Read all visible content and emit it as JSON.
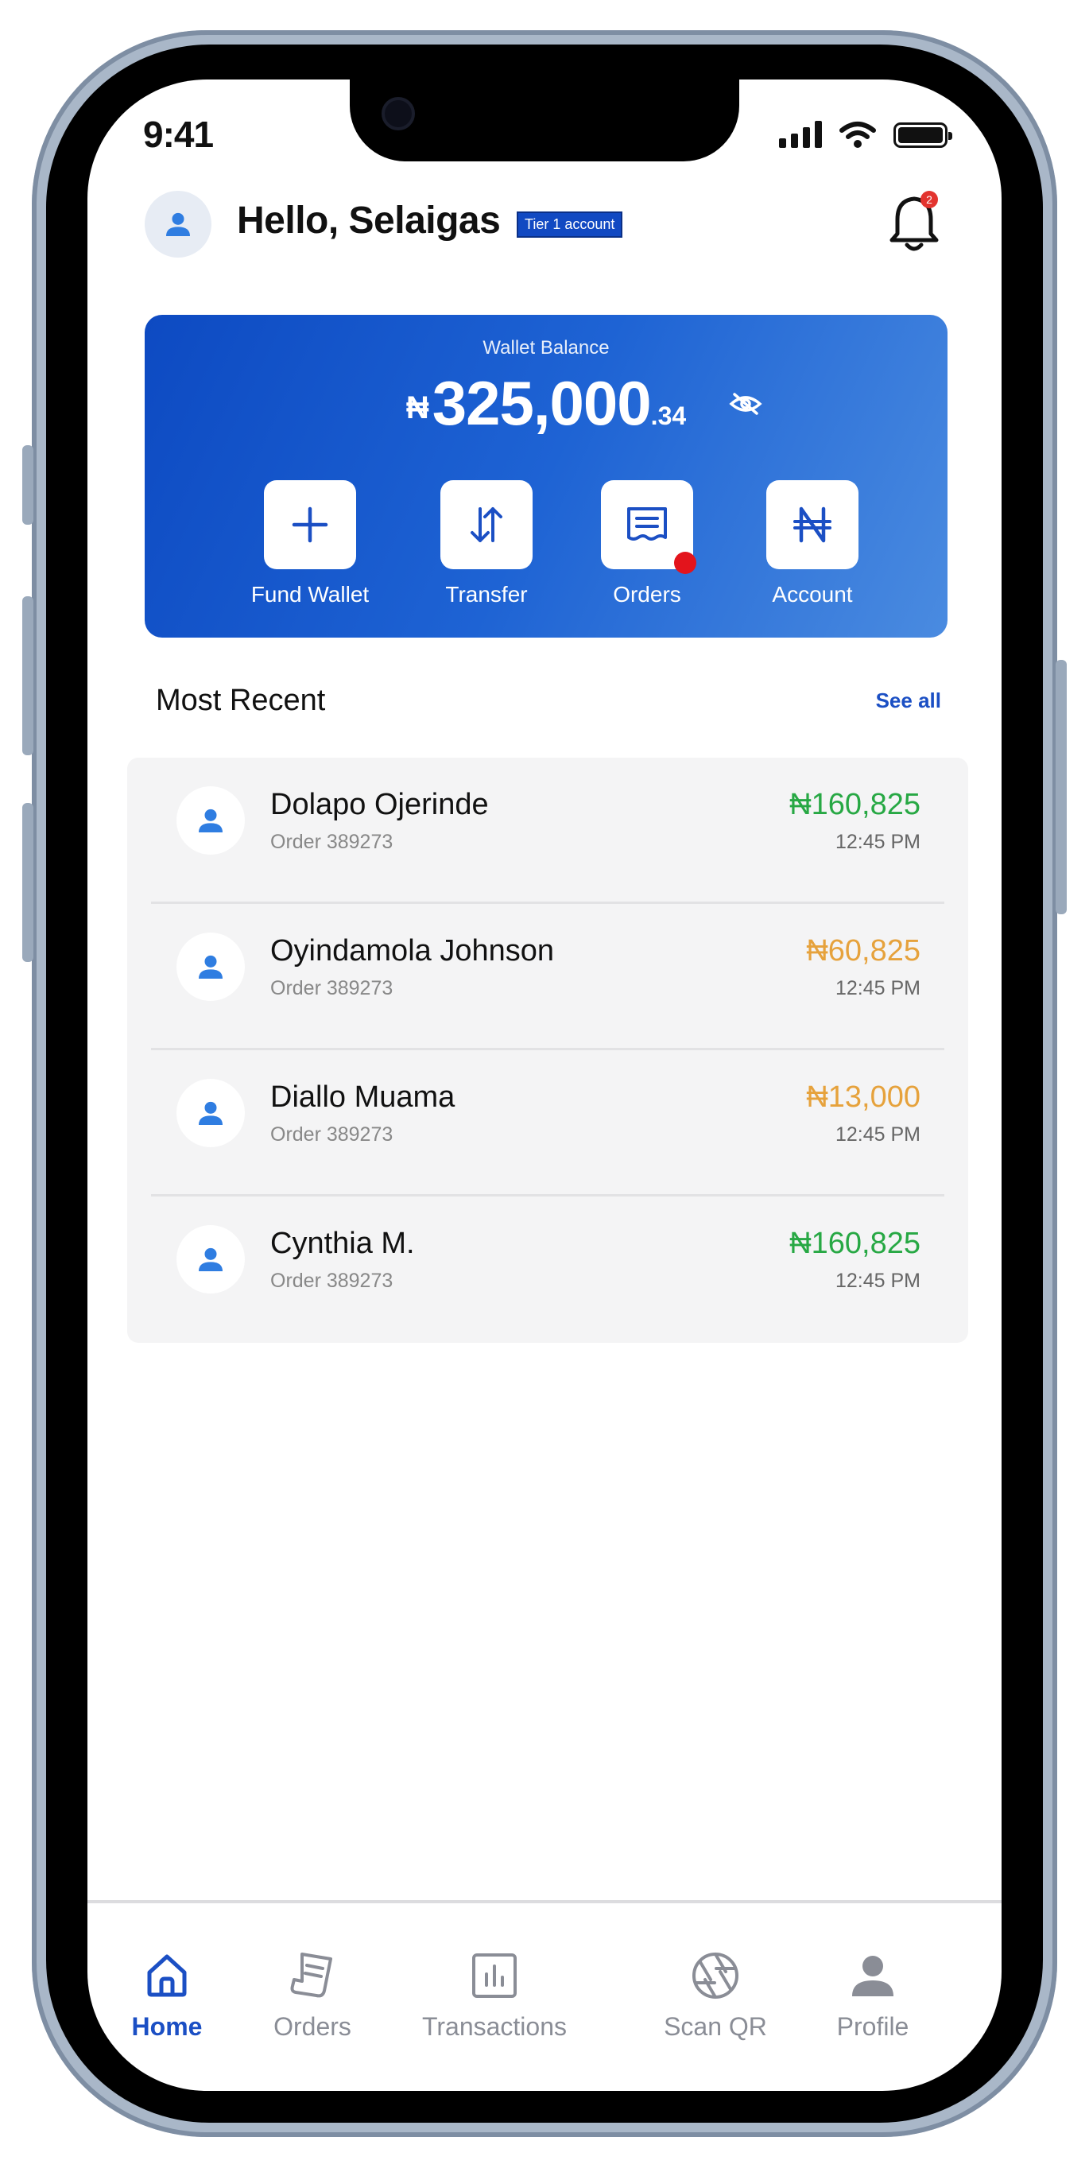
{
  "status_bar": {
    "time": "9:41"
  },
  "header": {
    "greeting": "Hello, Selaigas",
    "tier_badge": "Tier 1 account",
    "notification_count": "2"
  },
  "wallet": {
    "label": "Wallet Balance",
    "currency": "₦",
    "amount_main": "325,000",
    "amount_decimal": ".34",
    "actions": [
      {
        "label": "Fund Wallet",
        "icon": "plus-icon"
      },
      {
        "label": "Transfer",
        "icon": "transfer-arrows-icon"
      },
      {
        "label": "Orders",
        "icon": "receipt-icon"
      },
      {
        "label": "Account",
        "icon": "naira-icon"
      }
    ]
  },
  "recent": {
    "title": "Most Recent",
    "see_all": "See all",
    "items": [
      {
        "name": "Dolapo Ojerinde",
        "order": "Order 389273",
        "amount": "₦160,825",
        "time": "12:45 PM",
        "color": "#27a844"
      },
      {
        "name": "Oyindamola Johnson",
        "order": "Order 389273",
        "amount": "₦60,825",
        "time": "12:45 PM",
        "color": "#e6a23c"
      },
      {
        "name": "Diallo Muama",
        "order": "Order 389273",
        "amount": "₦13,000",
        "time": "12:45 PM",
        "color": "#e6a23c"
      },
      {
        "name": "Cynthia M.",
        "order": "Order 389273",
        "amount": "₦160,825",
        "time": "12:45 PM",
        "color": "#27a844"
      }
    ]
  },
  "nav": {
    "items": [
      {
        "label": "Home",
        "icon": "home-icon",
        "active": true
      },
      {
        "label": "Orders",
        "icon": "orders-icon",
        "active": false
      },
      {
        "label": "Transactions",
        "icon": "bar-chart-icon",
        "active": false
      },
      {
        "label": "Scan QR",
        "icon": "aperture-icon",
        "active": false
      },
      {
        "label": "Profile",
        "icon": "person-icon",
        "active": false
      }
    ]
  },
  "colors": {
    "brand": "#1b4fc4",
    "positive": "#27a844",
    "pending": "#e6a23c"
  }
}
